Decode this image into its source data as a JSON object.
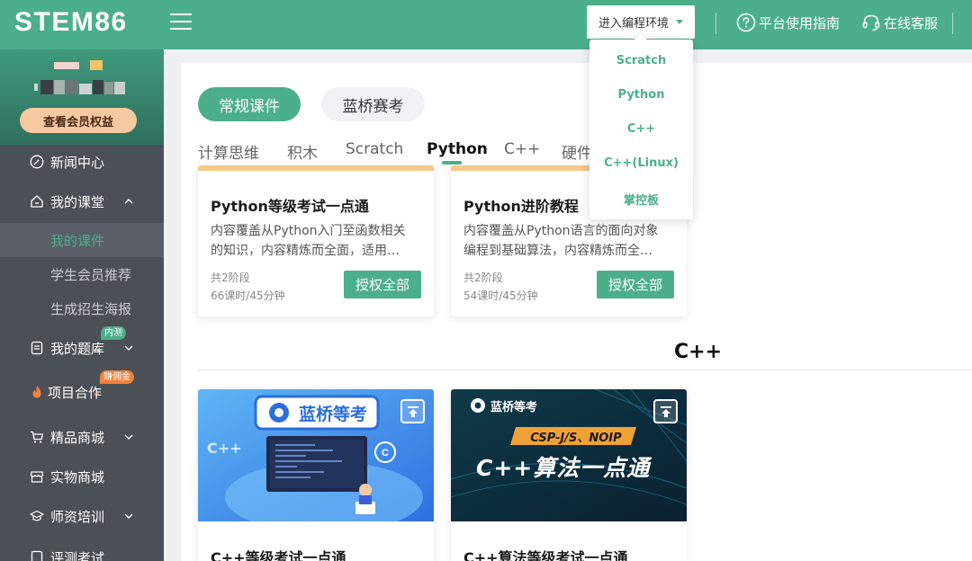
{
  "topbar": {
    "logo": "STEM86",
    "enter_button": "进入编程环境",
    "guide_link": "平台使用指南",
    "service_link": "在线客服"
  },
  "profile": {
    "member_button": "查看会员权益"
  },
  "sidebar": {
    "news": "新闻中心",
    "classroom": "我的课堂",
    "my_courses": "我的课件",
    "student_recommend": "学生会员推荐",
    "poster": "生成招生海报",
    "question_bank": "我的题库",
    "question_bank_tag": "内测",
    "project": "项目合作",
    "project_tag": "赚佣金",
    "mall": "精品商城",
    "physical_mall": "实物商城",
    "teacher_training": "师资培训",
    "evaluation": "评测考试"
  },
  "main": {
    "tab_regular": "常规课件",
    "tab_lanqiao": "蓝桥赛考",
    "subtabs": [
      "计算思维",
      "积木",
      "Scratch",
      "Python",
      "C++",
      "硬件"
    ],
    "cards": [
      {
        "title": "Python等级考试一点通",
        "desc_line1": "内容覆盖从Python入门至函数相关",
        "desc_line2": "的知识，内容精炼而全面，适用…",
        "stages": "共2阶段",
        "lessons": "66课时/45分钟",
        "button": "授权全部"
      },
      {
        "title": "Python进阶教程",
        "desc_line1": "内容覆盖从Python语言的面向对象",
        "desc_line2": "编程到基础算法，内容精炼而全…",
        "stages": "共2阶段",
        "lessons": "54课时/45分钟",
        "button": "授权全部"
      }
    ],
    "section_title": "C++",
    "img_cards": [
      {
        "banner_brand": "蓝桥等考",
        "banner_cpp": "C++",
        "title": "C++等级考试一点通"
      },
      {
        "banner_brand": "蓝桥等考",
        "banner_sub": "CSP-J/S、NOIP",
        "banner_main": "C++算法一点通",
        "title": "C++算法等级考试一点通"
      }
    ]
  },
  "dropdown": {
    "items": [
      "Scratch",
      "Python",
      "C++",
      "C++(Linux)",
      "掌控板"
    ]
  },
  "colors": {
    "brand": "#4caf8c",
    "sidebar": "#4b4f56",
    "orange_tag": "#f0833a"
  }
}
